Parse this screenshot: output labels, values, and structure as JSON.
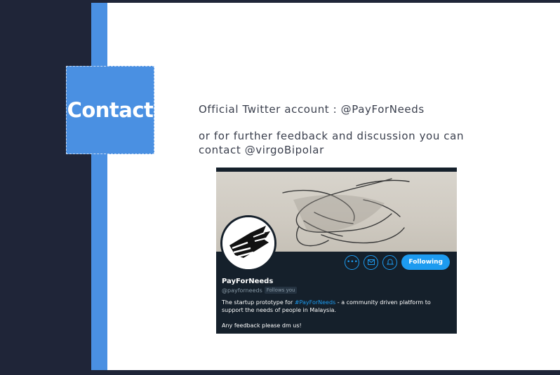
{
  "section": {
    "title": "Contact"
  },
  "contact": {
    "line1": "Official Twitter account : @PayForNeeds",
    "line2a": "or for further feedback and discussion you can",
    "line2b": "contact @virgoBipolar"
  },
  "twitter_card": {
    "name": "PayForNeeds",
    "handle": "@payforneeds",
    "follows_badge": "Follows you",
    "follow_button": "Following",
    "bio_prefix": "The startup prototype for ",
    "bio_hashtag": "#PayForNeeds",
    "bio_suffix": " - a community driven platform to support the needs of people in Malaysia.",
    "bio_line2": "Any feedback please dm us!",
    "icons": [
      "more-icon",
      "message-icon",
      "notification-icon"
    ]
  },
  "colors": {
    "accent": "#4a90e2",
    "sidebar": "#1f2538",
    "twitter_blue": "#1d9bf0",
    "card_bg": "#15202b"
  }
}
